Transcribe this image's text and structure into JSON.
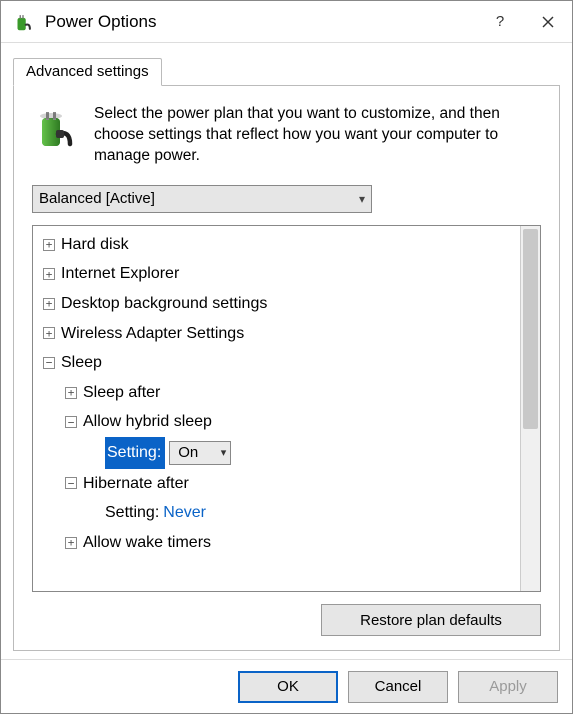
{
  "window": {
    "title": "Power Options"
  },
  "tab": {
    "label": "Advanced settings"
  },
  "description": "Select the power plan that you want to customize, and then choose settings that reflect how you want your computer to manage power.",
  "plan_select": {
    "value": "Balanced [Active]"
  },
  "tree": {
    "hard_disk": "Hard disk",
    "ie": "Internet Explorer",
    "desktop_bg": "Desktop background settings",
    "wireless": "Wireless Adapter Settings",
    "sleep": "Sleep",
    "sleep_after": "Sleep after",
    "allow_hybrid": "Allow hybrid sleep",
    "setting_label": "Setting:",
    "hybrid_value": "On",
    "hibernate_after": "Hibernate after",
    "hibernate_setting_label": "Setting:",
    "hibernate_value": "Never",
    "wake_timers": "Allow wake timers"
  },
  "buttons": {
    "restore": "Restore plan defaults",
    "ok": "OK",
    "cancel": "Cancel",
    "apply": "Apply"
  }
}
